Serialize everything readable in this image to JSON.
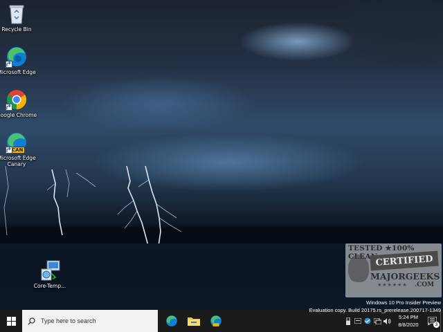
{
  "desktop": {
    "icons": [
      {
        "label": "Recycle Bin",
        "icon": "recycle-bin-icon"
      },
      {
        "label": "Microsoft Edge",
        "icon": "edge-icon"
      },
      {
        "label": "Google Chrome",
        "icon": "chrome-icon"
      },
      {
        "label": "Microsoft Edge Canary",
        "icon": "edge-canary-icon",
        "badge": "CAN"
      },
      {
        "label": "Core-Temp...",
        "icon": "installer-icon"
      }
    ]
  },
  "watermark": {
    "line1": "TESTED ★100% CLEAN",
    "line2": "CERTIFIED",
    "line3": "MAJORGEEKS",
    "line4": ".COM",
    "stars": "★★★★★★"
  },
  "evaluation": {
    "line1": "Windows 10 Pro Insider Preview",
    "line2": "Evaluation copy. Build 20175.rs_prerelease.200717-1349"
  },
  "taskbar": {
    "search_placeholder": "Type here to search",
    "pinned": [
      "edge-icon",
      "file-explorer-icon",
      "edge-canary-icon"
    ],
    "tray_icons": [
      "usb-icon",
      "keyboard-icon",
      "defender-icon",
      "network-icon",
      "volume-icon"
    ],
    "time": "5:24 PM",
    "date": "8/8/2020",
    "notification_count": "3"
  },
  "colors": {
    "taskbar_bg": "#1b1b1b",
    "search_bg": "#f2f2f2",
    "edge_blue": "#0f7fd6",
    "edge_green": "#4cc26b",
    "canary_gold": "#f4b400"
  }
}
